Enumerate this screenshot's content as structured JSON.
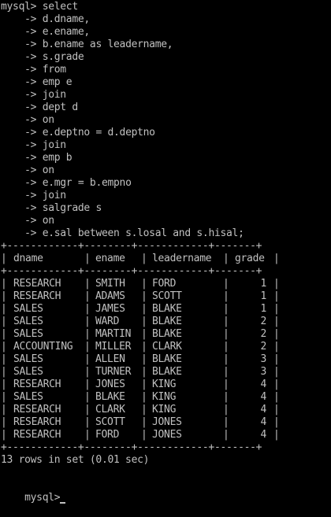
{
  "prompt": "mysql>",
  "continuation_prompt": "    ->",
  "query": {
    "first_line": "select",
    "continuation_lines": [
      "d.dname,",
      "e.ename,",
      "b.ename as leadername,",
      "s.grade",
      "from",
      "emp e",
      "join",
      "dept d",
      "on",
      "e.deptno = d.deptno",
      "join",
      "emp b",
      "on",
      "e.mgr = b.empno",
      "join",
      "salgrade s",
      "on",
      "e.sal between s.losal and s.hisal;"
    ]
  },
  "table": {
    "border_line": "+------------+--------+------------+-------+",
    "columns": [
      "dname",
      "ename",
      "leadername",
      "grade"
    ],
    "rows": [
      [
        "RESEARCH",
        "SMITH",
        "FORD",
        "1"
      ],
      [
        "RESEARCH",
        "ADAMS",
        "SCOTT",
        "1"
      ],
      [
        "SALES",
        "JAMES",
        "BLAKE",
        "1"
      ],
      [
        "SALES",
        "WARD",
        "BLAKE",
        "2"
      ],
      [
        "SALES",
        "MARTIN",
        "BLAKE",
        "2"
      ],
      [
        "ACCOUNTING",
        "MILLER",
        "CLARK",
        "2"
      ],
      [
        "SALES",
        "ALLEN",
        "BLAKE",
        "3"
      ],
      [
        "SALES",
        "TURNER",
        "BLAKE",
        "3"
      ],
      [
        "RESEARCH",
        "JONES",
        "KING",
        "4"
      ],
      [
        "SALES",
        "BLAKE",
        "KING",
        "4"
      ],
      [
        "RESEARCH",
        "CLARK",
        "KING",
        "4"
      ],
      [
        "RESEARCH",
        "SCOTT",
        "JONES",
        "4"
      ],
      [
        "RESEARCH",
        "FORD",
        "JONES",
        "4"
      ]
    ]
  },
  "result_summary": "13 rows in set (0.01 sec)",
  "final_prompt": "mysql>",
  "colors": {
    "background": "#000000",
    "text": "#c0c0c0"
  }
}
